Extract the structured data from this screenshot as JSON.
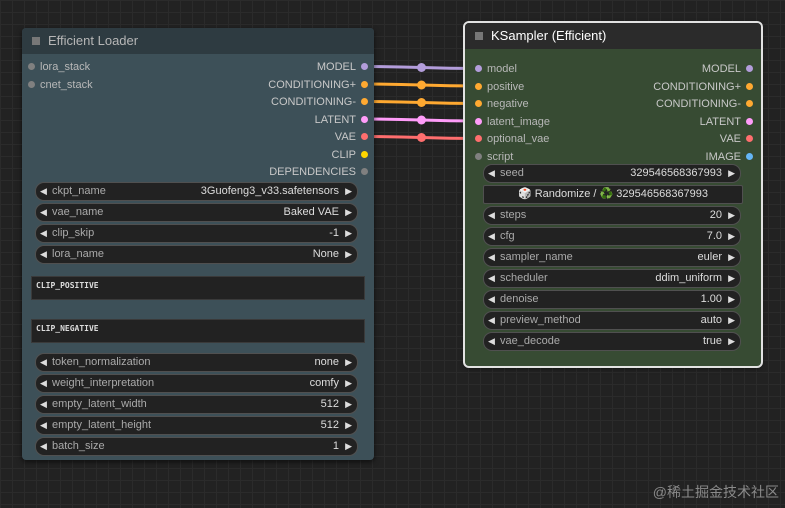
{
  "loader": {
    "title": "Efficient Loader",
    "inputs": [
      {
        "label": "lora_stack",
        "color": "#808080"
      },
      {
        "label": "cnet_stack",
        "color": "#808080"
      }
    ],
    "outputs": [
      {
        "label": "MODEL",
        "color": "#b39ddb"
      },
      {
        "label": "CONDITIONING+",
        "color": "#ffa931"
      },
      {
        "label": "CONDITIONING-",
        "color": "#ffa931"
      },
      {
        "label": "LATENT",
        "color": "#ff9cf9"
      },
      {
        "label": "VAE",
        "color": "#ff6e6e"
      },
      {
        "label": "CLIP",
        "color": "#ffd500"
      },
      {
        "label": "DEPENDENCIES",
        "color": "#808080"
      }
    ],
    "widgets_top": [
      {
        "name": "ckpt_name",
        "value": "3Guofeng3_v33.safetensors"
      },
      {
        "name": "vae_name",
        "value": "Baked VAE"
      },
      {
        "name": "clip_skip",
        "value": "-1"
      },
      {
        "name": "lora_name",
        "value": "None"
      }
    ],
    "clip_positive": "CLIP_POSITIVE",
    "clip_negative": "CLIP_NEGATIVE",
    "widgets_bottom": [
      {
        "name": "token_normalization",
        "value": "none"
      },
      {
        "name": "weight_interpretation",
        "value": "comfy"
      },
      {
        "name": "empty_latent_width",
        "value": "512"
      },
      {
        "name": "empty_latent_height",
        "value": "512"
      },
      {
        "name": "batch_size",
        "value": "1"
      }
    ]
  },
  "sampler": {
    "title": "KSampler (Efficient)",
    "inputs": [
      {
        "label": "model",
        "color": "#b39ddb"
      },
      {
        "label": "positive",
        "color": "#ffa931"
      },
      {
        "label": "negative",
        "color": "#ffa931"
      },
      {
        "label": "latent_image",
        "color": "#ff9cf9"
      },
      {
        "label": "optional_vae",
        "color": "#ff6e6e"
      },
      {
        "label": "script",
        "color": "#808080"
      }
    ],
    "outputs": [
      {
        "label": "MODEL",
        "color": "#b39ddb"
      },
      {
        "label": "CONDITIONING+",
        "color": "#ffa931"
      },
      {
        "label": "CONDITIONING-",
        "color": "#ffa931"
      },
      {
        "label": "LATENT",
        "color": "#ff9cf9"
      },
      {
        "label": "VAE",
        "color": "#ff6e6e"
      },
      {
        "label": "IMAGE",
        "color": "#64b5f6"
      }
    ],
    "seed": {
      "name": "seed",
      "value": "329546568367993"
    },
    "randomize_label": "🎲 Randomize / ♻️ 329546568367993",
    "widgets": [
      {
        "name": "steps",
        "value": "20"
      },
      {
        "name": "cfg",
        "value": "7.0"
      },
      {
        "name": "sampler_name",
        "value": "euler"
      },
      {
        "name": "scheduler",
        "value": "ddim_uniform"
      },
      {
        "name": "denoise",
        "value": "1.00"
      },
      {
        "name": "preview_method",
        "value": "auto"
      },
      {
        "name": "vae_decode",
        "value": "true"
      }
    ]
  },
  "links": [
    {
      "from": 0,
      "to": 0,
      "color": "#b39ddb"
    },
    {
      "from": 1,
      "to": 1,
      "color": "#ffa931"
    },
    {
      "from": 2,
      "to": 2,
      "color": "#ffa931"
    },
    {
      "from": 3,
      "to": 3,
      "color": "#ff9cf9"
    },
    {
      "from": 4,
      "to": 4,
      "color": "#ff6e6e"
    }
  ],
  "watermark": "@稀土掘金技术社区"
}
